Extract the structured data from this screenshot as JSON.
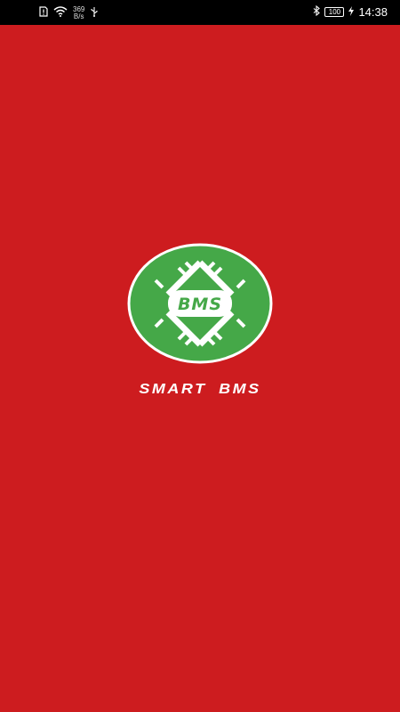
{
  "status_bar": {
    "net_speed_value": "369",
    "net_speed_unit": "B/s",
    "battery_level": "100",
    "time": "14:38"
  },
  "splash": {
    "logo_text": "BMS",
    "app_name": "SMART BMS"
  },
  "colors": {
    "background": "#cd1c1f",
    "logo_green": "#45a848",
    "status_bar": "#000000"
  },
  "icons": [
    "sim-alert-icon",
    "wifi-icon",
    "usb-icon",
    "bluetooth-icon",
    "battery-icon",
    "charging-icon"
  ]
}
